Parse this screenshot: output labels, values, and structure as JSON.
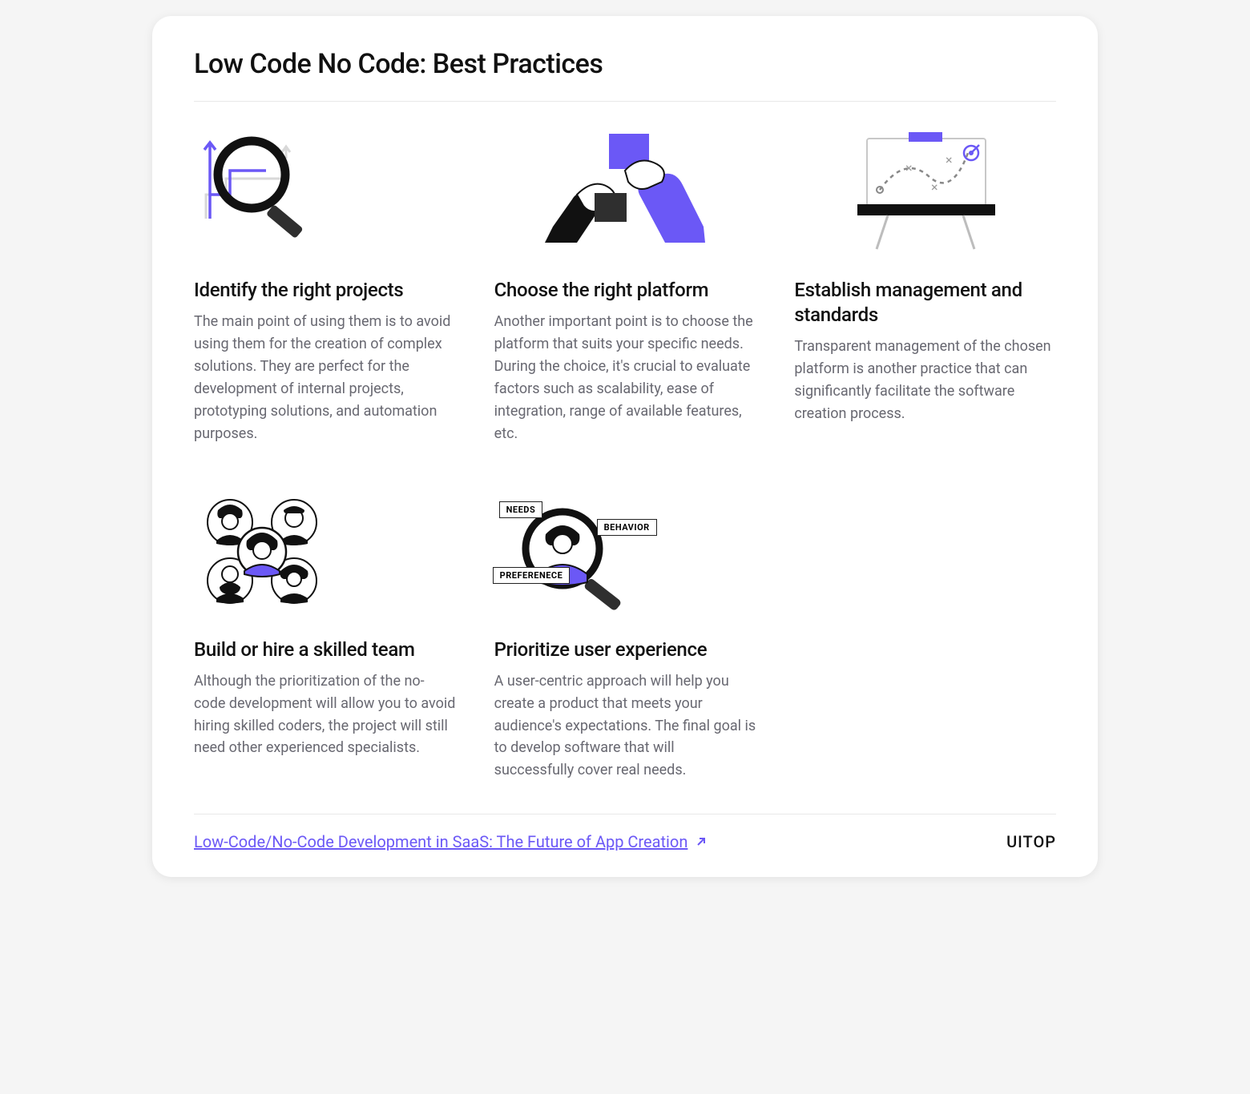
{
  "title": "Low Code No Code: Best Practices",
  "items": [
    {
      "title": "Identify the right projects",
      "desc": "The main point of using them is to avoid using them for the creation of complex solutions. They are perfect for the development of internal projects, prototyping solutions, and automation purposes."
    },
    {
      "title": "Choose the right platform",
      "desc": "Another important point is to choose the platform that suits your specific needs. During the choice, it's crucial to evaluate factors such as scalability, ease of integration, range of available features, etc."
    },
    {
      "title": "Establish management and standards",
      "desc": "Transparent management of the chosen platform is another practice that can significantly facilitate the software creation process."
    },
    {
      "title": "Build or hire a skilled team",
      "desc": "Although the prioritization of the no-code development will allow you to avoid hiring skilled coders, the project will still need other experienced specialists."
    },
    {
      "title": "Prioritize user experience",
      "desc": "A user-centric approach will help you create a product that meets your audience's expectations. The final goal is to develop software that will successfully cover real needs."
    }
  ],
  "labels": {
    "needs": "NEEDS",
    "behavior": "BEHAVIOR",
    "preference": "PREFERENECE"
  },
  "footer": {
    "link_text": "Low-Code/No-Code Development in SaaS: The Future of App Creation",
    "brand": "UITOP"
  },
  "colors": {
    "accent": "#6b58f6",
    "dark": "#1a1a1a",
    "grey": "#686871"
  }
}
